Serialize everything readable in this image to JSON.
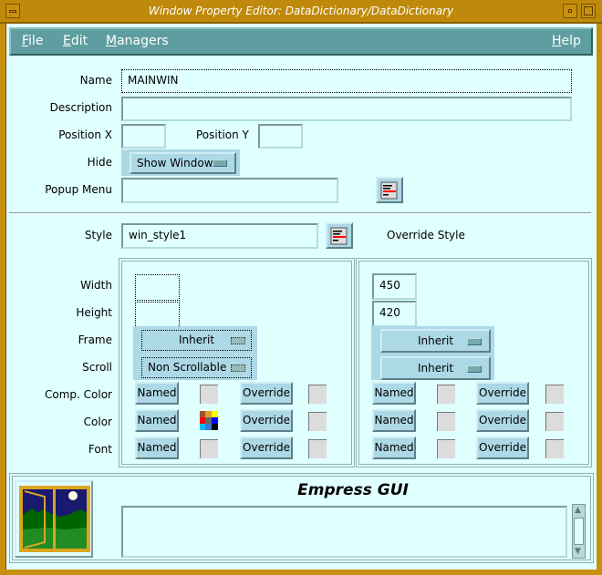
{
  "window": {
    "title": "Window Property Editor: DataDictionary/DataDictionary"
  },
  "menubar": {
    "file": "File",
    "edit": "Edit",
    "managers": "Managers",
    "help": "Help"
  },
  "form": {
    "name_label": "Name",
    "name_value": "MAINWIN",
    "description_label": "Description",
    "description_value": "",
    "position_x_label": "Position X",
    "position_x_value": "",
    "position_y_label": "Position Y",
    "position_y_value": "",
    "hide_label": "Hide",
    "hide_value": "Show Window",
    "popup_menu_label": "Popup Menu",
    "popup_menu_value": "",
    "style_label": "Style",
    "style_value": "win_style1",
    "override_style_label": "Override Style"
  },
  "rows": {
    "width": "Width",
    "height": "Height",
    "frame": "Frame",
    "scroll": "Scroll",
    "comp_color": "Comp. Color",
    "color": "Color",
    "font": "Font"
  },
  "style_panel": {
    "width": "",
    "height": "",
    "frame": "Inherit",
    "scroll": "Non Scrollable",
    "named": "Named",
    "override": "Override"
  },
  "override_panel": {
    "width": "450",
    "height": "420",
    "frame": "Inherit",
    "scroll": "Inherit",
    "named": "Named",
    "override": "Override"
  },
  "footer": {
    "title": "Empress GUI",
    "message": ""
  },
  "colors": {
    "titlebar": "#bf8a0c",
    "menubar": "#5f9ea0",
    "background": "#e0ffff",
    "button": "#add8e6"
  }
}
